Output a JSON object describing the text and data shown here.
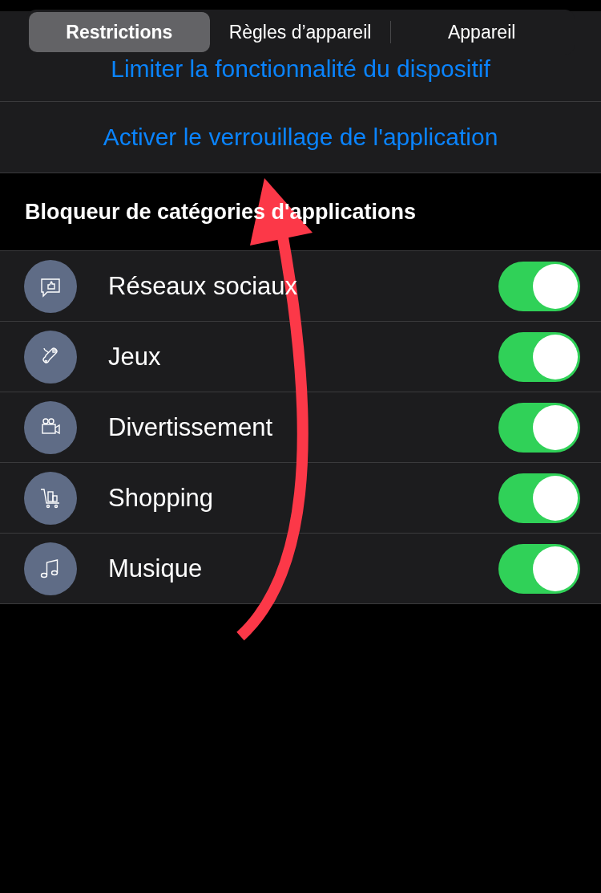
{
  "tabs": [
    {
      "label": "Restrictions",
      "selected": true
    },
    {
      "label": "Règles d’appareil",
      "selected": false
    },
    {
      "label": "Appareil",
      "selected": false
    }
  ],
  "actions": [
    "Limiter la fonctionnalité du dispositif",
    "Activer le verrouillage de l'application"
  ],
  "section_title": "Bloqueur de catégories d'applications",
  "categories": [
    {
      "kind": "social",
      "label": "Réseaux sociaux",
      "on": true
    },
    {
      "kind": "games",
      "label": "Jeux",
      "on": true
    },
    {
      "kind": "entertainment",
      "label": "Divertissement",
      "on": true
    },
    {
      "kind": "shopping",
      "label": "Shopping",
      "on": true
    },
    {
      "kind": "music",
      "label": "Musique",
      "on": true
    }
  ]
}
